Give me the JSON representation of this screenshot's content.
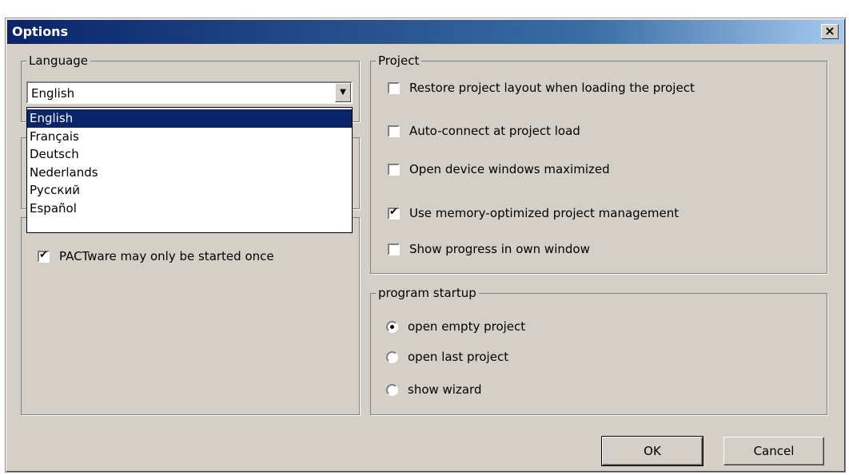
{
  "window": {
    "title": "Options",
    "close_label": "×"
  },
  "language": {
    "legend": "Language",
    "selected": "English",
    "options": [
      "English",
      "Français",
      "Deutsch",
      "Nederlands",
      "Русский",
      "Español"
    ],
    "dropdown_arrow": "▼"
  },
  "general": {
    "single_instance_label": "PACTware may only be started once",
    "single_instance_checked": true
  },
  "project": {
    "legend": "Project",
    "options": [
      {
        "label": "Restore project layout when loading the project",
        "checked": false
      },
      {
        "label": "Auto-connect at project load",
        "checked": false
      },
      {
        "label": "Open device windows maximized",
        "checked": false
      },
      {
        "label": "Use memory-optimized project management",
        "checked": true
      },
      {
        "label": "Show progress in own window",
        "checked": false
      }
    ]
  },
  "startup": {
    "legend": "program startup",
    "options": [
      {
        "label": "open empty project",
        "selected": true
      },
      {
        "label": "open last project",
        "selected": false
      },
      {
        "label": "show wizard",
        "selected": false
      }
    ]
  },
  "buttons": {
    "ok": "OK",
    "cancel": "Cancel"
  }
}
